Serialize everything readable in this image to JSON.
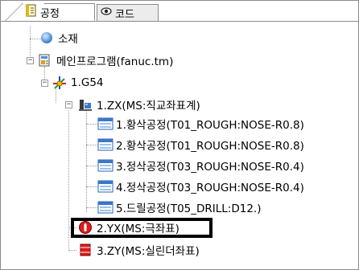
{
  "tabs": [
    {
      "label": "공정",
      "icon": "document-icon",
      "active": true
    },
    {
      "label": "코드",
      "icon": "eye-icon",
      "active": false
    }
  ],
  "tree": {
    "material": {
      "label": "소재",
      "icon": "sphere-icon"
    },
    "main_program": {
      "label": "메인프로그램(fanuc.tm)",
      "icon": "program-icon",
      "expanded": true
    },
    "coordinate": {
      "label": "1.G54",
      "icon": "coordinate-axes-icon",
      "expanded": true
    },
    "zx": {
      "label": "1.ZX(MS:직교좌표계)",
      "icon": "machine-icon",
      "expanded": true
    },
    "operations": [
      {
        "label": "1.황삭공정(T01_ROUGH:NOSE-R0.8)",
        "icon": "operation-icon"
      },
      {
        "label": "2.황삭공정(T01_ROUGH:NOSE-R0.8)",
        "icon": "operation-icon"
      },
      {
        "label": "3.정삭공정(T03_ROUGH:NOSE-R0.4)",
        "icon": "operation-icon"
      },
      {
        "label": "4.정삭공정(T03_ROUGH:NOSE-R0.4)",
        "icon": "operation-icon"
      },
      {
        "label": "5.드릴공정(T05_DRILL:D12.)",
        "icon": "operation-icon"
      }
    ],
    "yx": {
      "label": "2.YX(MS:극좌표)",
      "icon": "polar-icon",
      "highlighted": true
    },
    "zy": {
      "label": "3.ZY(MS:실린더좌표)",
      "icon": "cylinder-icon"
    }
  },
  "colors": {
    "accent_red": "#d81e1e",
    "operation_blue": "#3a78c9",
    "material_blue": "#4a8fd8"
  }
}
